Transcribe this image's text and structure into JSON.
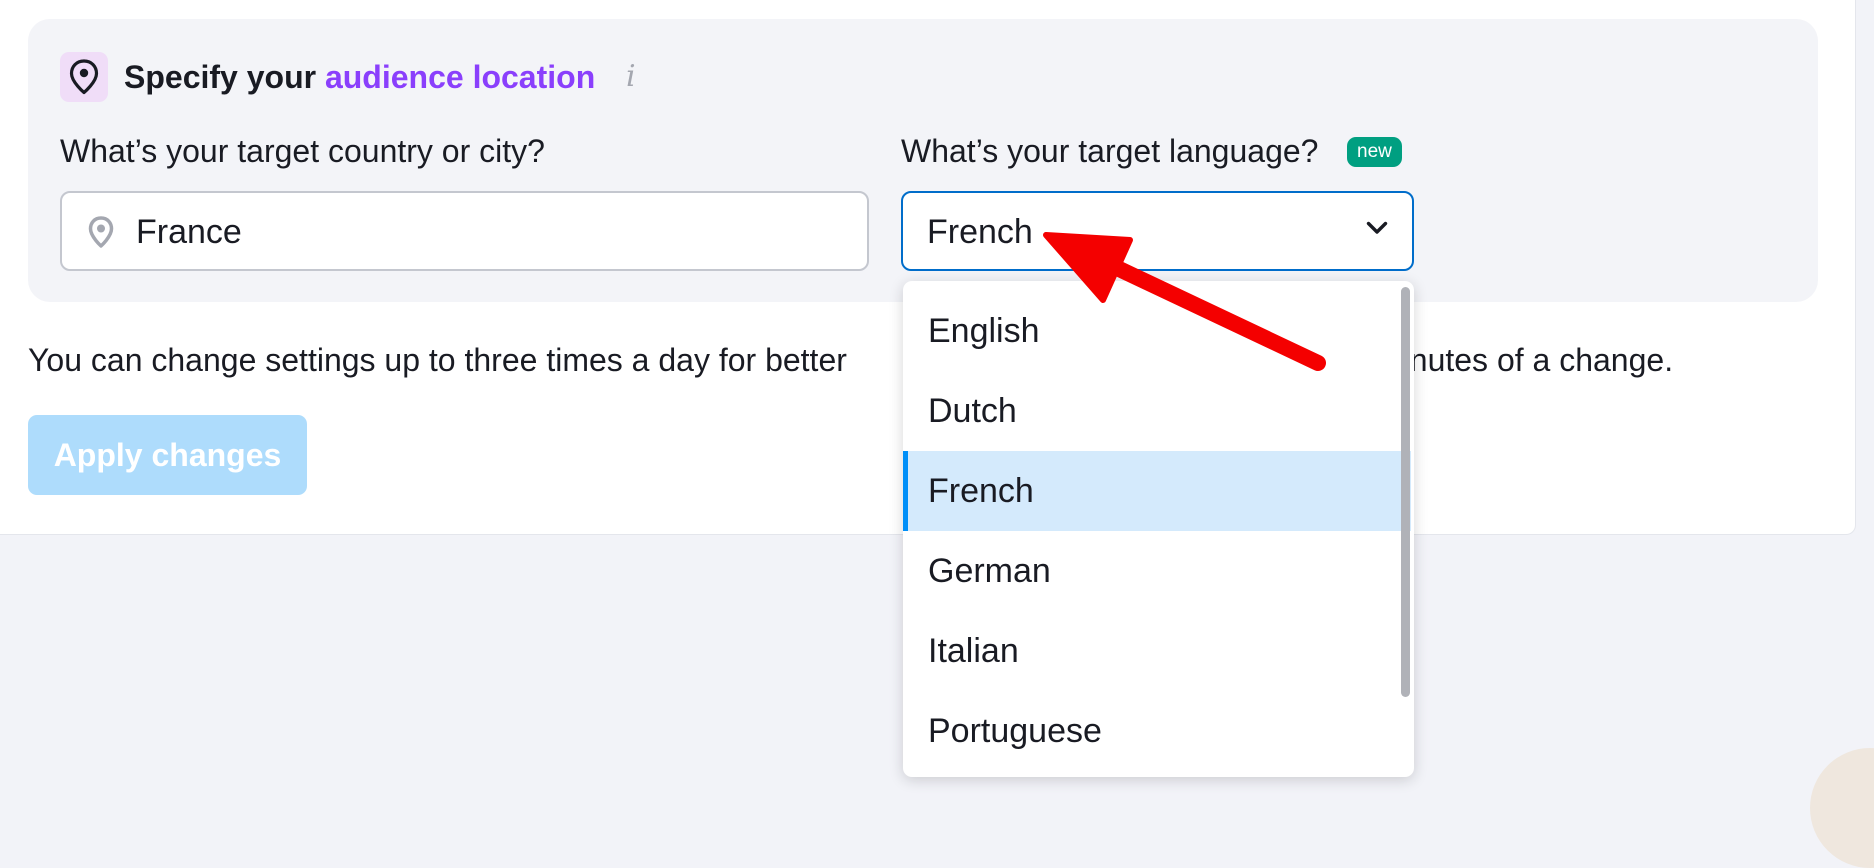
{
  "section": {
    "heading_prefix": "Specify your",
    "heading_accent": "audience location",
    "info_glyph": "i",
    "accent_color": "#8a3ffc"
  },
  "country": {
    "label": "What’s your target country or city?",
    "value": "France"
  },
  "language": {
    "label": "What’s your target language?",
    "badge": "new",
    "value": "French"
  },
  "note": "You can change settings up to three times a day for better",
  "note_tail": "minutes of a change.",
  "apply_button": "Apply changes",
  "dropdown": {
    "options": [
      "English",
      "Dutch",
      "French",
      "German",
      "Italian",
      "Portuguese"
    ],
    "selected_index": 2
  },
  "icons": {
    "location": "location-pin-icon",
    "info": "info-icon",
    "chevron": "chevron-down-icon"
  },
  "colors": {
    "badge_green": "#009f81",
    "selected_bg": "#d4eafc",
    "select_border": "#006dca",
    "button_disabled": "#aedcfc",
    "annotation_arrow": "#f40000"
  }
}
